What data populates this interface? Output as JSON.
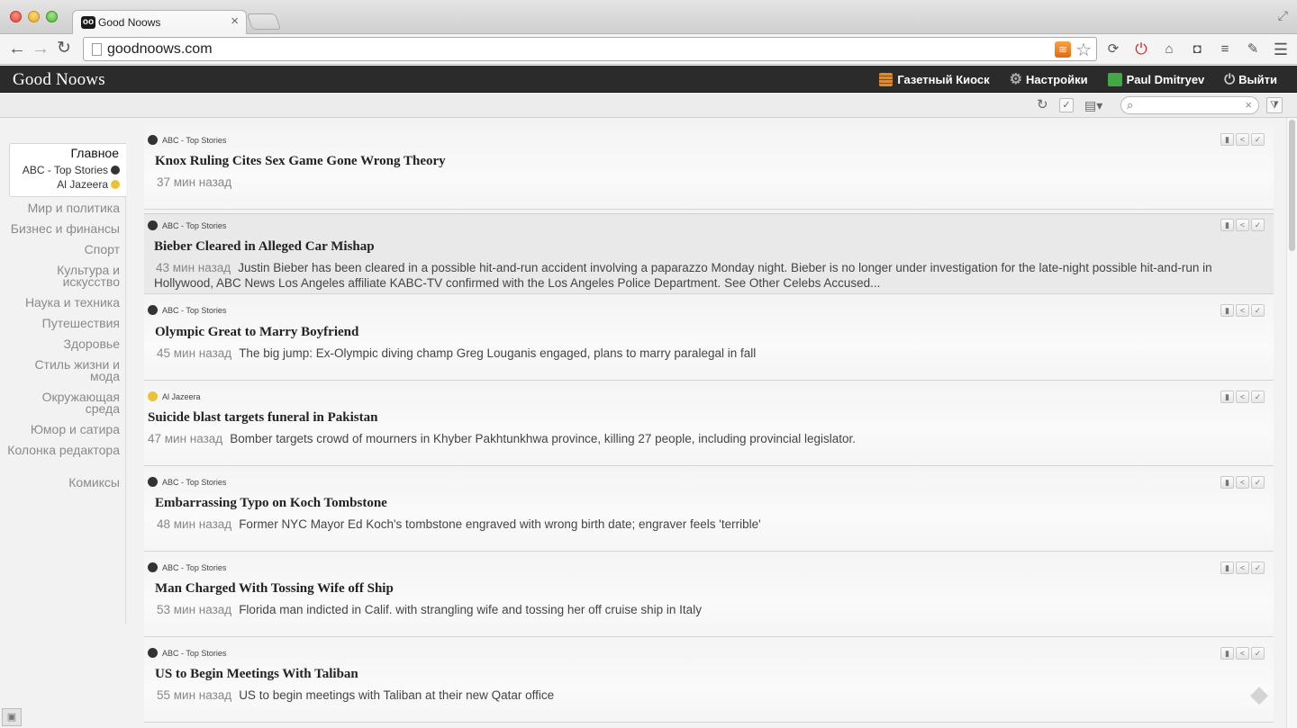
{
  "browser": {
    "tab_title": "Good Noows",
    "tab_favicon": "oo",
    "url": "goodnoows.com",
    "rss_glyph": "≋"
  },
  "app": {
    "brand": "Good Noows",
    "nav": [
      {
        "label": "Газетный Киоск",
        "icon": "kiosk-icon"
      },
      {
        "label": "Настройки",
        "icon": "gear-icon"
      },
      {
        "label": "Paul Dmitryev",
        "icon": "user-icon"
      },
      {
        "label": "Выйти",
        "icon": "power-icon"
      }
    ]
  },
  "search": {
    "placeholder": "",
    "value": ""
  },
  "sidebar": {
    "active": "Главное",
    "feeds": [
      "ABC - Top Stories",
      "Al Jazeera"
    ],
    "categories": [
      "Мир и политика",
      "Бизнес и финансы",
      "Спорт",
      "Культура и искусство",
      "Наука и техника",
      "Путешествия",
      "Здоровье",
      "Стиль жизни и мода",
      "Окружающая среда",
      "Юмор и сатира",
      "Колонка редактора",
      "Комиксы"
    ]
  },
  "items": [
    {
      "source": "ABC - Top Stories",
      "title": "Knox Ruling Cites Sex Game Gone Wrong Theory",
      "time": "37 мин назад",
      "summary": ""
    },
    {
      "source": "ABC - Top Stories",
      "title": "Bieber Cleared in Alleged Car Mishap",
      "time": "43 мин назад",
      "summary": "Justin Bieber has been cleared in a possible hit-and-run accident involving a paparazzo Monday night. Bieber is no longer under investigation for the late-night possible hit-and-run in Hollywood, ABC News Los Angeles affiliate KABC-TV confirmed with the Los Angeles Police Department. See Other Celebs Accused..."
    },
    {
      "source": "ABC - Top Stories",
      "title": "Olympic Great to Marry Boyfriend",
      "time": "45 мин назад",
      "summary": "The big jump: Ex-Olympic diving champ Greg Louganis engaged, plans to marry paralegal in fall"
    },
    {
      "source": "Al Jazeera",
      "title": "Suicide blast targets funeral in Pakistan",
      "time": "47 мин назад",
      "summary": "Bomber targets crowd of mourners in Khyber Pakhtunkhwa province, killing 27 people, including provincial legislator."
    },
    {
      "source": "ABC - Top Stories",
      "title": "Embarrassing Typo on Koch Tombstone",
      "time": "48 мин назад",
      "summary": "Former NYC Mayor Ed Koch's tombstone engraved with wrong birth date; engraver feels 'terrible'"
    },
    {
      "source": "ABC - Top Stories",
      "title": "Man Charged With Tossing Wife off Ship",
      "time": "53 мин назад",
      "summary": "Florida man indicted in Calif. with strangling wife and tossing her off cruise ship in Italy"
    },
    {
      "source": "ABC - Top Stories",
      "title": "US to Begin Meetings With Taliban",
      "time": "55 мин назад",
      "summary": "US to begin meetings with Taliban at their new Qatar office"
    }
  ],
  "colors": {
    "appbar": "#2b2b2b",
    "accent_kiosk": "#e08a2a",
    "accent_user": "#43a843"
  }
}
